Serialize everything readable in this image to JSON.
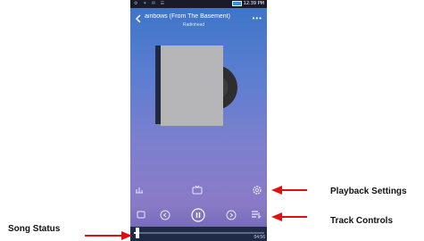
{
  "status_bar": {
    "left_icons": "⚙ ✶ ✉ ☰",
    "time": "12:39 PM"
  },
  "header": {
    "title": "ainbows (From The Basement)",
    "artist": "Radiohead",
    "more": "•••"
  },
  "player": {
    "progress_fraction": 0.03,
    "time_end": "04:56"
  },
  "icons": {
    "back": "chevron-left",
    "settings_row": [
      "equalizer-icon",
      "tv-icon",
      "settings-gear-icon"
    ],
    "controls_row": [
      "queue-icon",
      "previous-icon",
      "pause-icon",
      "next-icon",
      "playlist-icon"
    ]
  },
  "annotations": {
    "playback_settings": "Playback Settings",
    "track_controls": "Track Controls",
    "song_status": "Song Status"
  },
  "colors": {
    "arrow": "#e01010",
    "accent": "#3b74c8"
  }
}
